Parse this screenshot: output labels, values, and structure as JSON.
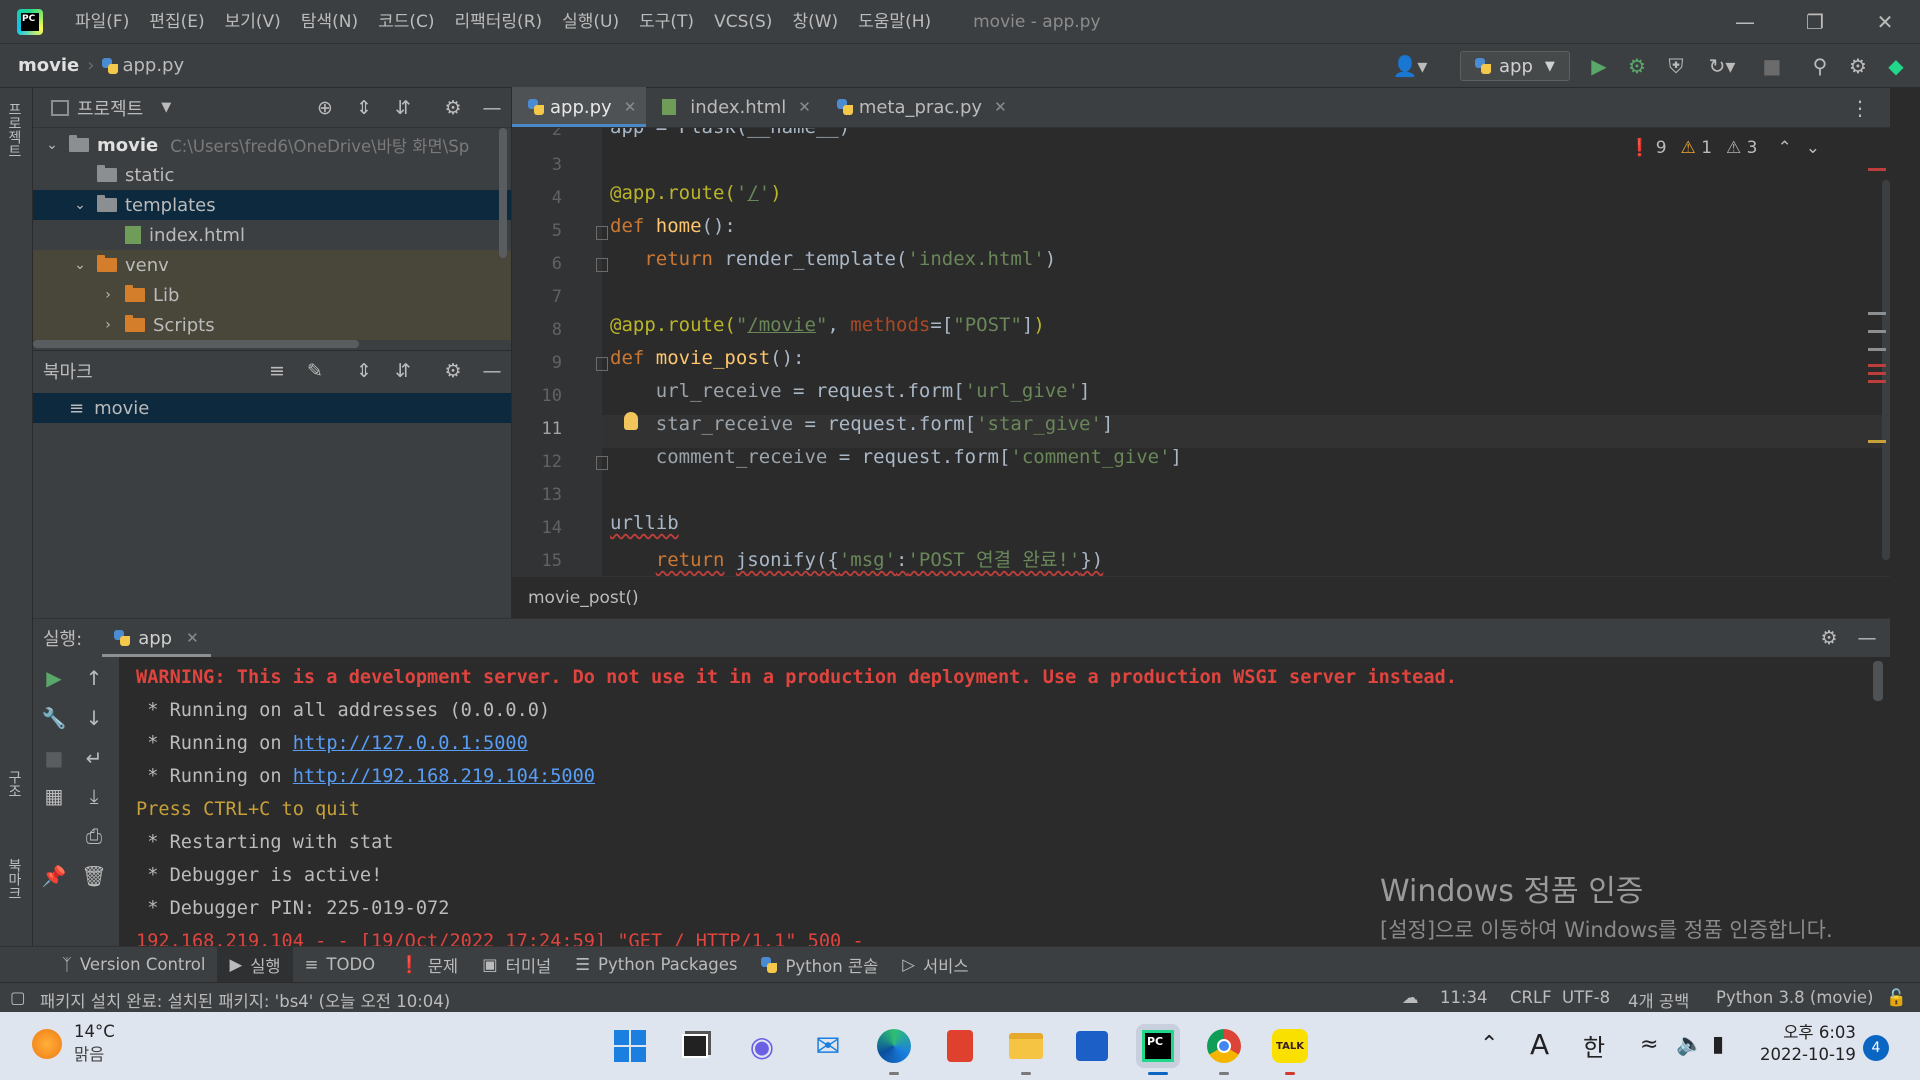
{
  "titlebar": {
    "logo": "PC",
    "menu": [
      "파일(F)",
      "편집(E)",
      "보기(V)",
      "탐색(N)",
      "코드(C)",
      "리팩터링(R)",
      "실행(U)",
      "도구(T)",
      "VCS(S)",
      "창(W)",
      "도움말(H)"
    ],
    "window_title": "movie - app.py"
  },
  "navbar": {
    "project": "movie",
    "file": "app.py",
    "run_config": "app"
  },
  "left_strip": {
    "top": "프로젝트",
    "mid": "구조",
    "bottom": "북마크"
  },
  "project_panel": {
    "title": "프로젝트",
    "tree": [
      {
        "label": "movie",
        "path": "C:\\Users\\fred6\\OneDrive\\바탕 화면\\Sp",
        "type": "folder",
        "expanded": true
      },
      {
        "label": "static",
        "type": "folder"
      },
      {
        "label": "templates",
        "type": "folder",
        "expanded": true
      },
      {
        "label": "index.html",
        "type": "html"
      },
      {
        "label": "venv",
        "type": "folder-orange",
        "expanded": true
      },
      {
        "label": "Lib",
        "type": "folder-orange"
      },
      {
        "label": "Scripts",
        "type": "folder-orange"
      }
    ]
  },
  "bookmark_panel": {
    "title": "북마크",
    "items": [
      "movie"
    ]
  },
  "editor": {
    "tabs": [
      {
        "label": "app.py",
        "active": true
      },
      {
        "label": "index.html",
        "active": false
      },
      {
        "label": "meta_prac.py",
        "active": false
      }
    ],
    "inspection": {
      "errors": "9",
      "warnings": "1",
      "weak": "3"
    },
    "line_numbers": [
      "2",
      "3",
      "4",
      "5",
      "6",
      "7",
      "8",
      "9",
      "10",
      "11",
      "12",
      "13",
      "14",
      "15"
    ],
    "current_line": "11",
    "breadcrumb": "movie_post()"
  },
  "run_panel": {
    "label": "실행:",
    "tab": "app",
    "console": {
      "warning": "WARNING: This is a development server. Do not use it in a production deployment. Use a production WSGI server instead.",
      "l1": " * Running on all addresses (0.0.0.0)",
      "l2_prefix": " * Running on ",
      "l2_link": "http://127.0.0.1:5000",
      "l3_prefix": " * Running on ",
      "l3_link": "http://192.168.219.104:5000",
      "l4": "Press CTRL+C to quit",
      "l5": " * Restarting with stat",
      "l6": " * Debugger is active!",
      "l7": " * Debugger PIN: 225-019-072",
      "l8": "192.168.219.104 - - [19/Oct/2022 17:24:59] \"GET / HTTP/1.1\" 500 -"
    }
  },
  "watermark": {
    "title": "Windows 정품 인증",
    "body": "[설정]으로 이동하여 Windows를 정품 인증합니다."
  },
  "tool_tabs": [
    "Version Control",
    "실행",
    "TODO",
    "문제",
    "터미널",
    "Python Packages",
    "Python 콘솔",
    "서비스"
  ],
  "status_bar": {
    "message": "패키지 설치 완료: 설치된 패키지: 'bs4' (오늘 오전 10:04)",
    "position": "11:34",
    "line_sep": "CRLF",
    "encoding": "UTF-8",
    "indent": "4개 공백",
    "interpreter": "Python 3.8 (movie)"
  },
  "taskbar": {
    "temp": "14°C",
    "weather": "맑음",
    "ime_a": "A",
    "ime_han": "한",
    "time": "오후 6:03",
    "date": "2022-10-19",
    "notifications": "4",
    "kakao": "TALK"
  },
  "colors": {
    "accent": "#4a88c7",
    "error": "#e0443e",
    "link": "#589df6"
  }
}
